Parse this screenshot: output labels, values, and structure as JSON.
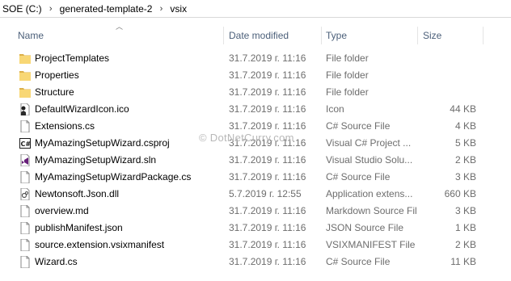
{
  "breadcrumb": [
    "SOE (C:)",
    "generated-template-2",
    "vsix"
  ],
  "columns": {
    "name": "Name",
    "date": "Date modified",
    "type": "Type",
    "size": "Size"
  },
  "files": [
    {
      "name": "ProjectTemplates",
      "date": "31.7.2019 г. 11:16",
      "type": "File folder",
      "size": "",
      "icon": "folder-icon"
    },
    {
      "name": "Properties",
      "date": "31.7.2019 г. 11:16",
      "type": "File folder",
      "size": "",
      "icon": "folder-icon"
    },
    {
      "name": "Structure",
      "date": "31.7.2019 г. 11:16",
      "type": "File folder",
      "size": "",
      "icon": "folder-icon"
    },
    {
      "name": "DefaultWizardIcon.ico",
      "date": "31.7.2019 г. 11:16",
      "type": "Icon",
      "size": "44 KB",
      "icon": "ico-file-icon"
    },
    {
      "name": "Extensions.cs",
      "date": "31.7.2019 г. 11:16",
      "type": "C# Source File",
      "size": "4 KB",
      "icon": "cs-file-icon"
    },
    {
      "name": "MyAmazingSetupWizard.csproj",
      "date": "31.7.2019 г. 11:16",
      "type": "Visual C# Project ...",
      "size": "5 KB",
      "icon": "csproj-file-icon"
    },
    {
      "name": "MyAmazingSetupWizard.sln",
      "date": "31.7.2019 г. 11:16",
      "type": "Visual Studio Solu...",
      "size": "2 KB",
      "icon": "sln-file-icon"
    },
    {
      "name": "MyAmazingSetupWizardPackage.cs",
      "date": "31.7.2019 г. 11:16",
      "type": "C# Source File",
      "size": "3 KB",
      "icon": "cs-file-icon"
    },
    {
      "name": "Newtonsoft.Json.dll",
      "date": "5.7.2019 г. 12:55",
      "type": "Application extens...",
      "size": "660 KB",
      "icon": "dll-file-icon"
    },
    {
      "name": "overview.md",
      "date": "31.7.2019 г. 11:16",
      "type": "Markdown Source File",
      "size": "3 KB",
      "icon": "md-file-icon"
    },
    {
      "name": "publishManifest.json",
      "date": "31.7.2019 г. 11:16",
      "type": "JSON Source File",
      "size": "1 KB",
      "icon": "json-file-icon"
    },
    {
      "name": "source.extension.vsixmanifest",
      "date": "31.7.2019 г. 11:16",
      "type": "VSIXMANIFEST File",
      "size": "2 KB",
      "icon": "vsixmanifest-file-icon"
    },
    {
      "name": "Wizard.cs",
      "date": "31.7.2019 г. 11:16",
      "type": "C# Source File",
      "size": "11 KB",
      "icon": "cs-file-icon"
    }
  ],
  "watermark": "© DotNetCurry.com"
}
